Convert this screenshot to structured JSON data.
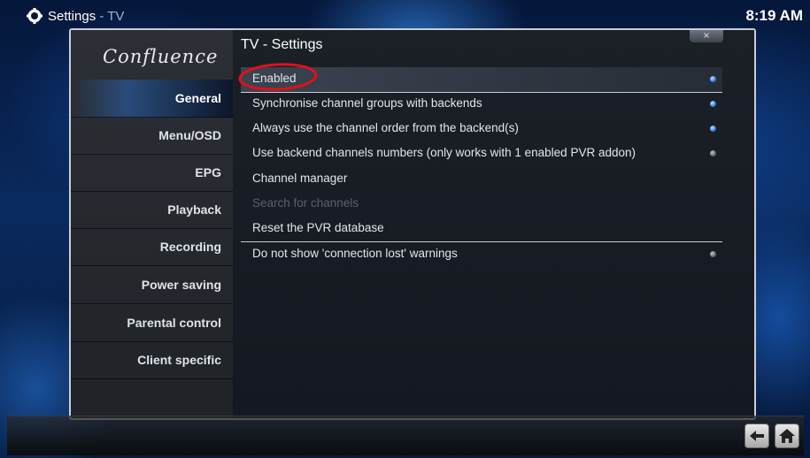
{
  "topbar": {
    "section": "Settings",
    "separator": " - ",
    "subsection": "TV",
    "clock": "8:19 AM"
  },
  "logo": "Confluence",
  "sidebar": {
    "items": [
      {
        "label": "General",
        "active": true
      },
      {
        "label": "Menu/OSD"
      },
      {
        "label": "EPG"
      },
      {
        "label": "Playback"
      },
      {
        "label": "Recording"
      },
      {
        "label": "Power saving"
      },
      {
        "label": "Parental control"
      },
      {
        "label": "Client specific"
      }
    ]
  },
  "content": {
    "title": "TV - Settings",
    "close_label": "×",
    "rows": [
      {
        "label": "Enabled",
        "toggle": "on",
        "focused": true,
        "separator_after": true
      },
      {
        "label": "Synchronise channel groups with backends",
        "toggle": "on"
      },
      {
        "label": "Always use the channel order from the backend(s)",
        "toggle": "on"
      },
      {
        "label": "Use backend channels numbers (only works with 1 enabled PVR addon)",
        "toggle": "off"
      },
      {
        "label": "Channel manager"
      },
      {
        "label": "Search for channels",
        "disabled": true
      },
      {
        "label": "Reset the PVR database",
        "separator_after": true
      },
      {
        "label": "Do not show 'connection lost' warnings",
        "toggle": "off"
      }
    ]
  },
  "colors": {
    "toggle_on": "#1d6fd8",
    "toggle_off": "#555a62",
    "annotation": "#e0101a"
  },
  "icons": {
    "title_icon": "settings-gear-icon",
    "back": "back-arrow-icon",
    "home": "home-icon"
  }
}
